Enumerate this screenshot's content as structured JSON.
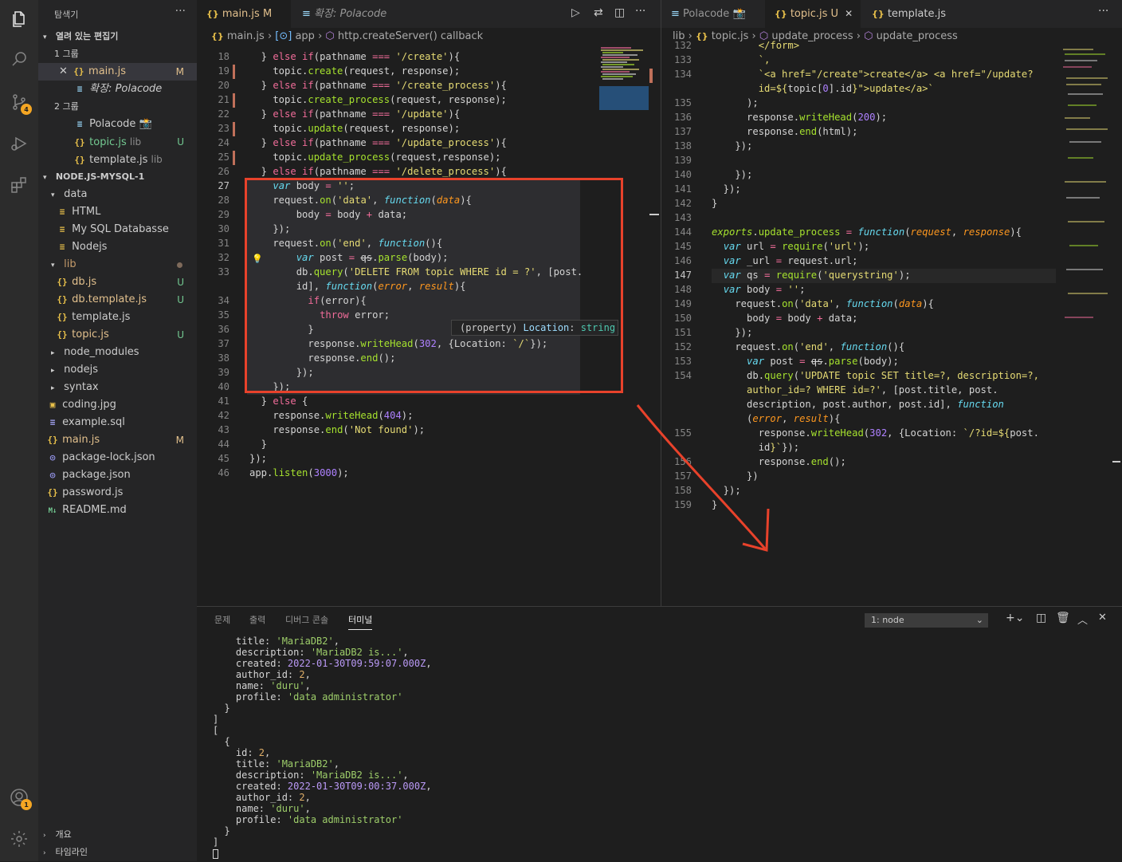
{
  "sidebar": {
    "title": "탐색기",
    "open_editors": "열려 있는 편집기",
    "group1": "1 그룹",
    "group2": "2 그룹",
    "open_items": [
      {
        "name": "main.js",
        "status": "M"
      },
      {
        "name": "확장: Polacode"
      },
      {
        "name": "Polacode 📸"
      },
      {
        "name": "topic.js",
        "desc": "lib",
        "status": "U"
      },
      {
        "name": "template.js",
        "desc": "lib"
      }
    ],
    "project": "NODE.JS-MYSQL-1",
    "tree": [
      {
        "name": "data"
      },
      {
        "name": "HTML"
      },
      {
        "name": "My SQL Databasse"
      },
      {
        "name": "Nodejs"
      },
      {
        "name": "lib"
      },
      {
        "name": "db.js",
        "status": "U"
      },
      {
        "name": "db.template.js",
        "status": "U"
      },
      {
        "name": "template.js"
      },
      {
        "name": "topic.js",
        "status": "U"
      },
      {
        "name": "node_modules"
      },
      {
        "name": "nodejs"
      },
      {
        "name": "syntax"
      },
      {
        "name": "coding.jpg"
      },
      {
        "name": "example.sql"
      },
      {
        "name": "main.js",
        "status": "M"
      },
      {
        "name": "package-lock.json"
      },
      {
        "name": "package.json"
      },
      {
        "name": "password.js"
      },
      {
        "name": "README.md"
      }
    ],
    "outline": "개요",
    "timeline": "타임라인"
  },
  "activity": {
    "scm_badge": "4",
    "account_badge": "1"
  },
  "left_editor": {
    "tabs": [
      {
        "label": "main.js",
        "status": "M"
      },
      {
        "label": "확장: Polacode"
      }
    ],
    "breadcrumb": [
      "main.js",
      "app",
      "http.createServer() callback"
    ],
    "line_numbers": [
      "18",
      "19",
      "20",
      "21",
      "22",
      "23",
      "24",
      "25",
      "26",
      "27",
      "28",
      "29",
      "30",
      "31",
      "32",
      "33",
      "",
      "34",
      "35",
      "36",
      "37",
      "38",
      "39",
      "40",
      "41",
      "42",
      "43",
      "44",
      "45",
      "46"
    ],
    "hover": {
      "kw": "(property)",
      "name": "Location",
      "type": "string"
    }
  },
  "right_editor": {
    "tabs": [
      {
        "label": "Polacode 📸"
      },
      {
        "label": "topic.js",
        "status": "U"
      },
      {
        "label": "template.js"
      }
    ],
    "breadcrumb": [
      "lib",
      "topic.js",
      "update_process",
      "update_process"
    ],
    "line_numbers": [
      "132",
      "133",
      "134",
      "",
      "135",
      "136",
      "137",
      "138",
      "139",
      "140",
      "141",
      "142",
      "143",
      "144",
      "145",
      "146",
      "147",
      "148",
      "149",
      "150",
      "151",
      "152",
      "153",
      "154",
      "",
      "",
      "",
      "155",
      "",
      "156",
      "157",
      "158",
      "159"
    ]
  },
  "panel": {
    "tabs": [
      "문제",
      "출력",
      "디버그 콘솔",
      "터미널"
    ],
    "terminal_select": "1: node"
  }
}
